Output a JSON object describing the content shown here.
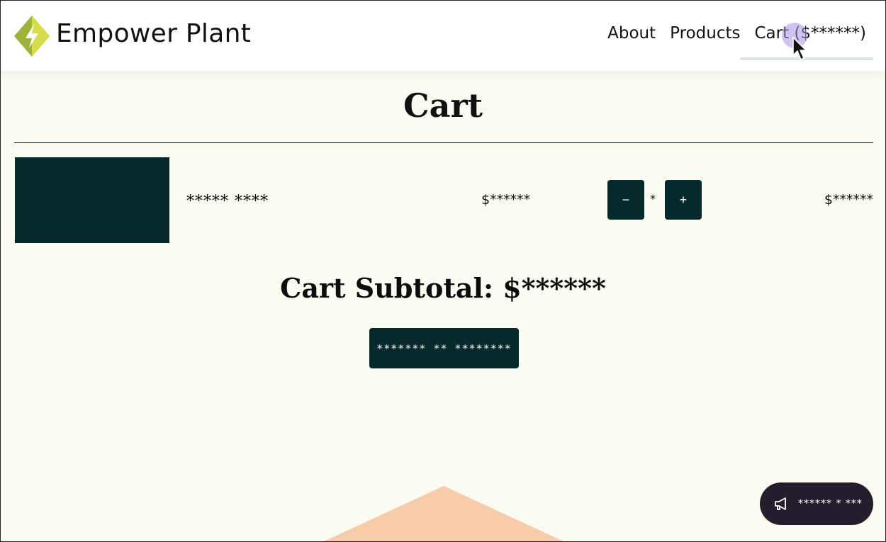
{
  "brand": {
    "name": "Empower Plant",
    "icon": "bolt-leaf-logo"
  },
  "nav": {
    "about": "About",
    "products": "Products",
    "cart": "Cart ($******)"
  },
  "page": {
    "title": "Cart"
  },
  "cart_item": {
    "name": "***** ****",
    "price": "$******",
    "quantity": "*",
    "decrease_label": "−",
    "increase_label": "+",
    "line_total": "$******",
    "thumbnail_color": "#03292a"
  },
  "summary": {
    "subtotal": "Cart Subtotal: $******",
    "checkout_label": "******* ** ********"
  },
  "feedback": {
    "label": "****** * ***",
    "icon": "megaphone-icon"
  },
  "colors": {
    "accent": "#03292a",
    "background": "#fbfbf1",
    "decor": "#f5cba9"
  }
}
